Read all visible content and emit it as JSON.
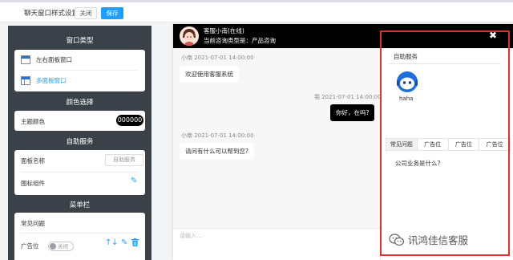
{
  "toolbar": {
    "title": "聊天窗口样式设置",
    "close_label": "关闭",
    "save_label": "保存"
  },
  "left_panel": {
    "window_type": {
      "heading": "窗口类型",
      "options": [
        {
          "label": "左右面板窗口",
          "icon": "window-split-icon",
          "active": false
        },
        {
          "label": "多面板窗口",
          "icon": "window-multi-icon",
          "active": true
        }
      ]
    },
    "color": {
      "heading": "颜色选择",
      "theme_label": "主题颜色",
      "theme_value": "000000"
    },
    "self_service": {
      "heading": "自助服务",
      "panel_name_label": "面板名称",
      "panel_name_value": "自助服务",
      "icon_component_label": "图标组件"
    },
    "menu_bar": {
      "heading": "菜单栏",
      "item1_label": "常见问题",
      "item2_label": "广告位",
      "toggle_text": "关闭"
    }
  },
  "chat": {
    "header": {
      "name": "客服小南(在线)",
      "consult_type": "当前咨询类型是：产品咨询"
    },
    "messages": [
      {
        "meta": "小南 2021-07-01 14:00:00",
        "text": "欢迎使用客服系统",
        "side": "in"
      },
      {
        "meta": "我 2021-07-01 14:00:00",
        "text": "你好，在吗?",
        "side": "out"
      },
      {
        "meta": "小南 2021-07-01 14:00:00",
        "text": "请问有什么可以帮到您?",
        "side": "in"
      }
    ],
    "input_placeholder": "请输入..."
  },
  "self_service_panel": {
    "title": "自助服务",
    "bot_label": "haha",
    "tabs": [
      "常见问题",
      "广告位",
      "广告位",
      "广告位"
    ],
    "faq_item": "公司业务是什么?"
  },
  "watermark": {
    "text": "讯鸿佳信客服"
  },
  "colors": {
    "accent": "#1e9fff",
    "theme": "#000000",
    "highlight": "#e0302a",
    "left_panel_bg": "#3b4148"
  }
}
